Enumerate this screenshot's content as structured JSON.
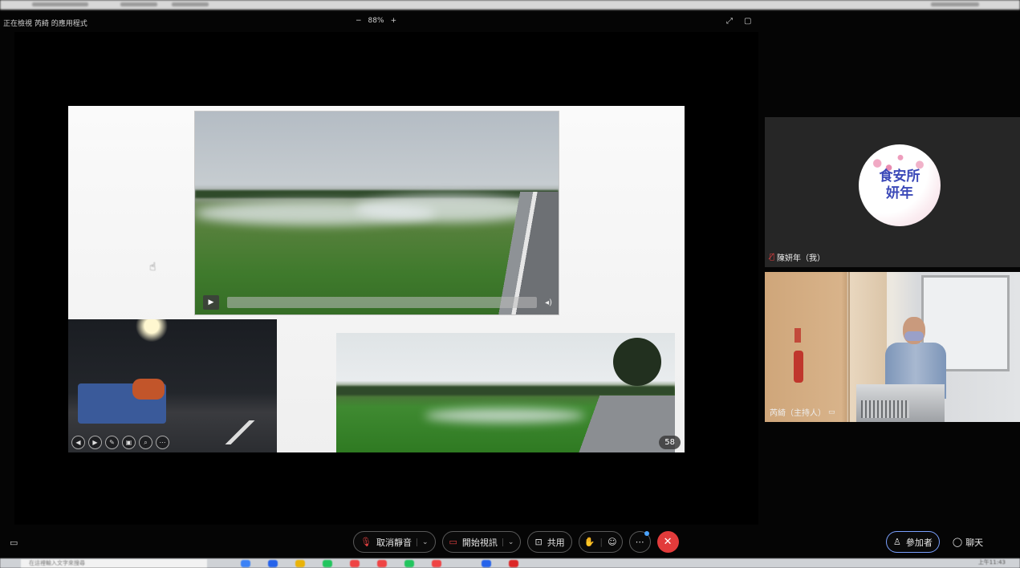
{
  "window": {
    "share_label": "正在檢視 芮綺 的應用程式",
    "zoom_minus": "−",
    "zoom_level": "88%",
    "zoom_plus": "+"
  },
  "slide": {
    "page_number": "58",
    "video_progress": 0.0
  },
  "participants": {
    "self": {
      "avatar_line1": "食安所",
      "avatar_line2": "妍年",
      "name": "陳妍年（我）"
    },
    "host": {
      "name": "芮綺（主持人）",
      "sign": "CO2"
    }
  },
  "toolbar": {
    "mute_label": "取消靜音",
    "video_label": "開始視訊",
    "share_label": "共用",
    "participants_label": "參加者",
    "chat_label": "聊天"
  },
  "taskbar": {
    "search_placeholder": "在這裡輸入文字來搜尋",
    "time": "上午11:43"
  },
  "colors": {
    "end_call": "#e23b3b",
    "muted_icon": "#e04040",
    "notify_dot": "#4aa3ff"
  }
}
